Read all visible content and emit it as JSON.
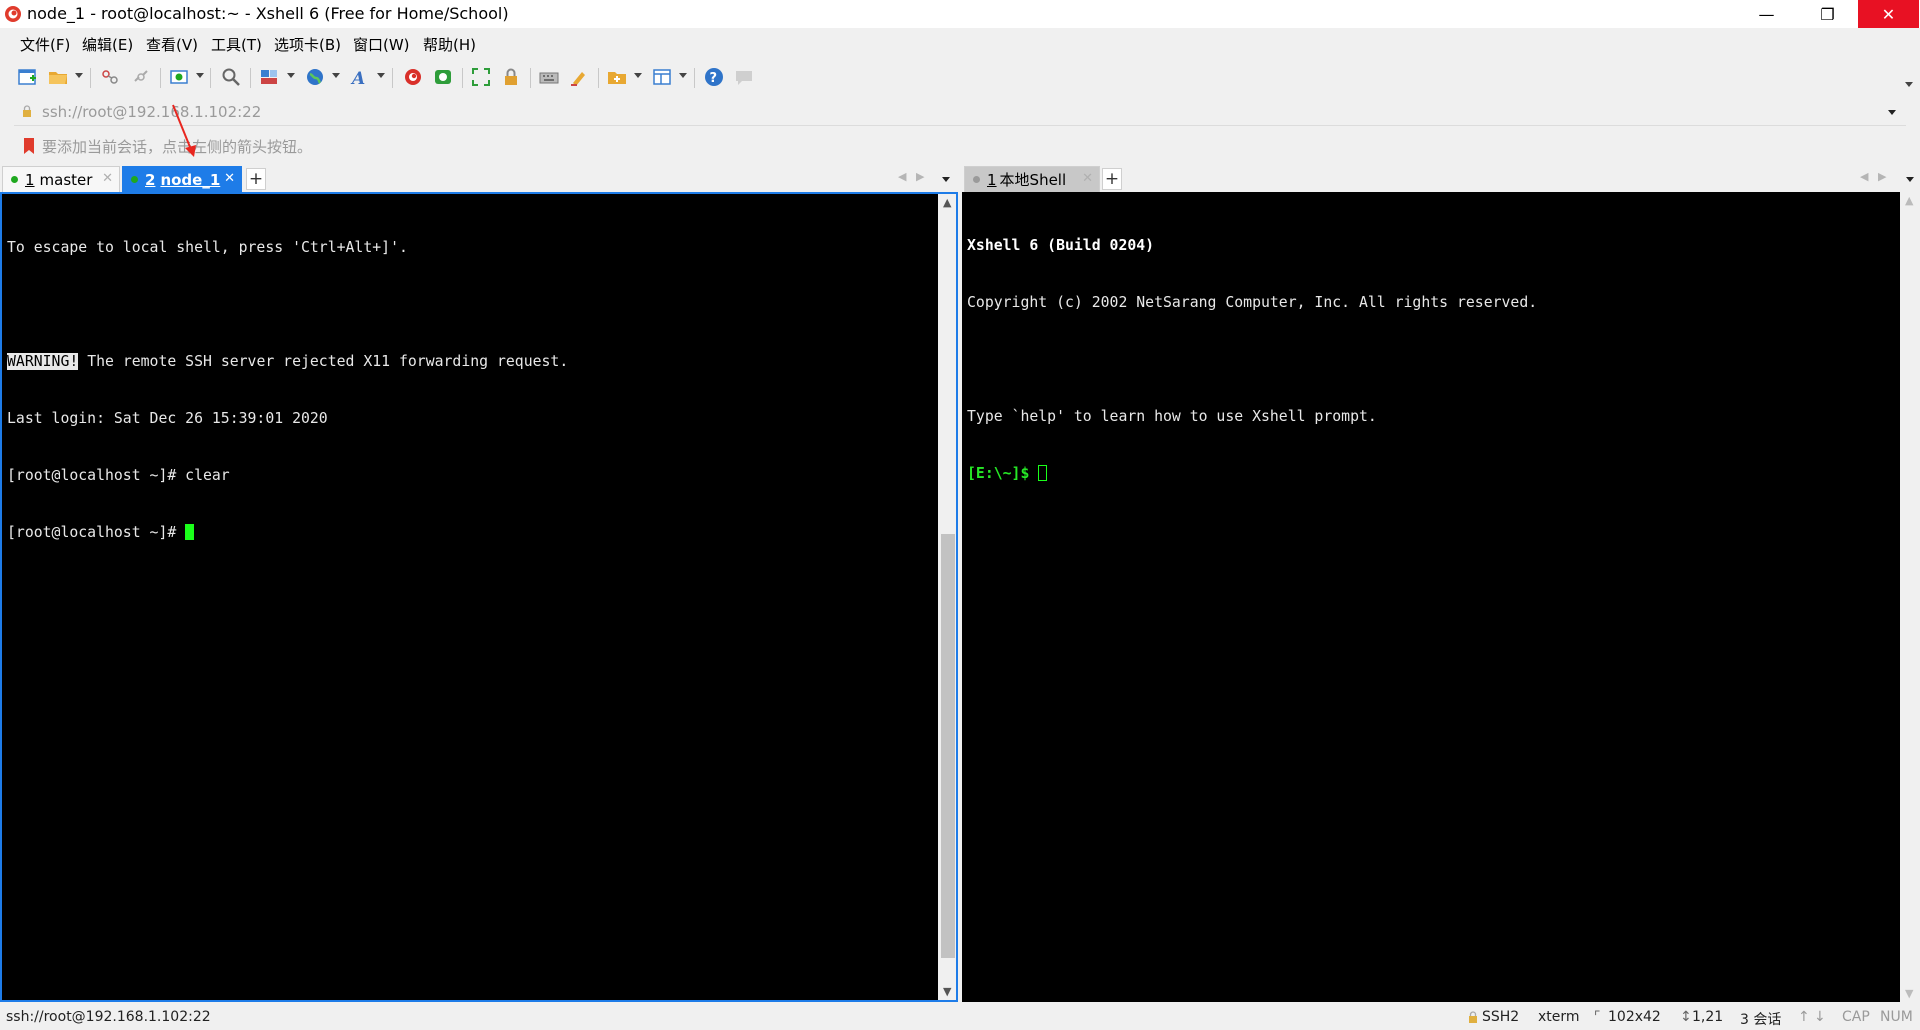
{
  "window": {
    "title": "node_1 - root@localhost:~ - Xshell 6 (Free for Home/School)",
    "minimize": "—",
    "maximize": "❐",
    "close": "✕"
  },
  "menu": [
    "文件(F)",
    "编辑(E)",
    "查看(V)",
    "工具(T)",
    "选项卡(B)",
    "窗口(W)",
    "帮助(H)"
  ],
  "address": {
    "value": "ssh://root@192.168.1.102:22"
  },
  "hint": {
    "text": "要添加当前会话，点击左侧的箭头按钮。"
  },
  "left_tabs": [
    {
      "number": "1",
      "label": "master",
      "dot_color": "#1fa81f"
    },
    {
      "number": "2",
      "label": "node_1",
      "dot_color": "#1fa81f"
    }
  ],
  "right_tabs": [
    {
      "number": "1",
      "label": "本地Shell",
      "dot_color": "#9a9a9a"
    }
  ],
  "tab_add": "+",
  "left_terminal": {
    "line1": "To escape to local shell, press 'Ctrl+Alt+]'.",
    "warning_tag": "WARNING!",
    "warning_text": " The remote SSH server rejected X11 forwarding request.",
    "line4": "Last login: Sat Dec 26 15:39:01 2020",
    "line5": "[root@localhost ~]# clear",
    "line6": "[root@localhost ~]# "
  },
  "right_terminal": {
    "line1": "Xshell 6 (Build 0204)",
    "line2": "Copyright (c) 2002 NetSarang Computer, Inc. All rights reserved.",
    "line4": "Type `help' to learn how to use Xshell prompt.",
    "prompt": "[E:\\~]$ "
  },
  "status": {
    "connection": "ssh://root@192.168.1.102:22",
    "protocol": "SSH2",
    "terminal_type": "xterm",
    "size": "102x42",
    "cursor_pos": "1,21",
    "sessions": "3 会话",
    "caps": "CAP",
    "num": "NUM"
  },
  "colors": {
    "accent": "#1e7ce8",
    "close_red": "#e81123",
    "terminal_bg": "#000000",
    "cursor_green": "#1aff1a"
  }
}
